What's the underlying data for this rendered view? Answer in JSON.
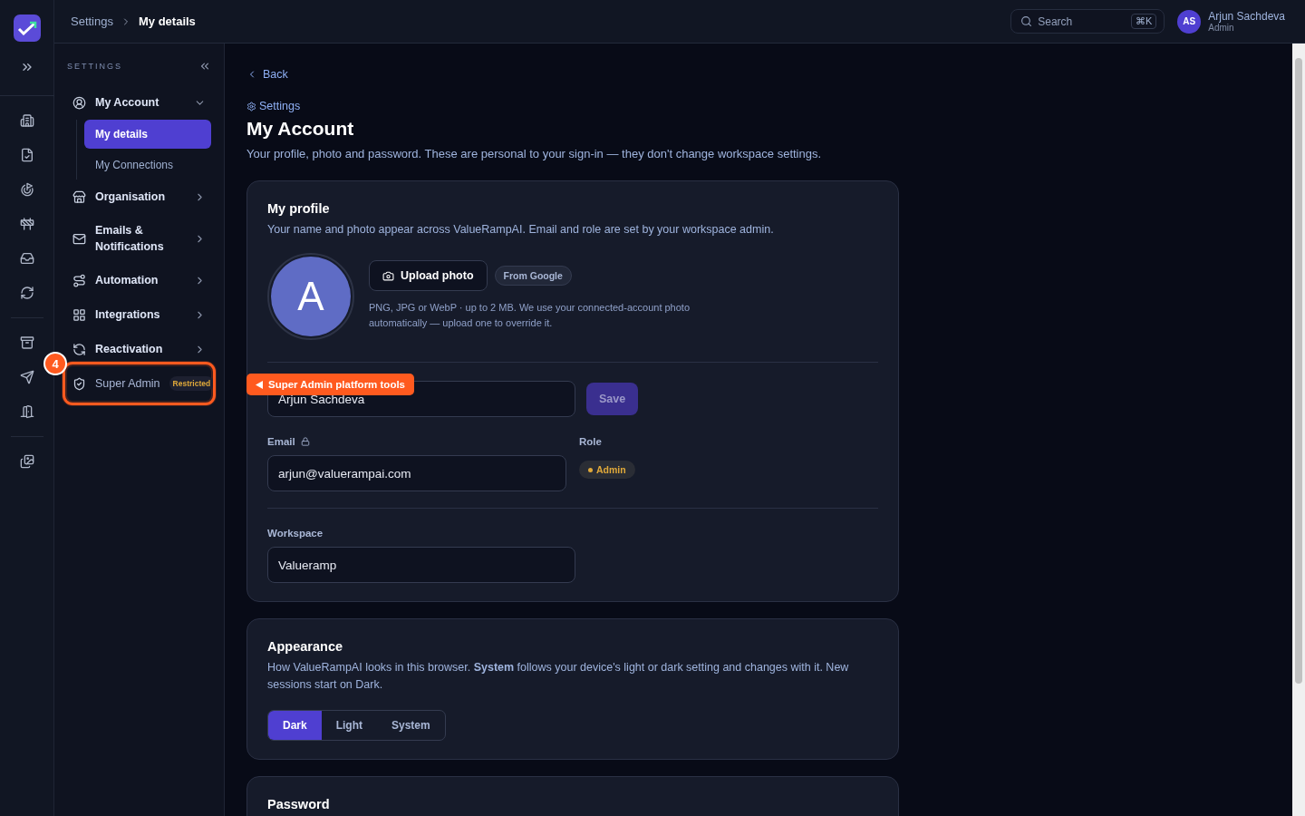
{
  "header": {
    "breadcrumb": [
      {
        "label": "Settings",
        "current": false
      },
      {
        "label": "My details",
        "current": true
      }
    ],
    "search": {
      "placeholder": "Search",
      "shortcut": "⌘K"
    },
    "user": {
      "initials": "AS",
      "name": "Arjun Sachdeva",
      "role": "Admin"
    }
  },
  "sidebar": {
    "heading": "SETTINGS",
    "items": [
      {
        "label": "My Account",
        "expanded": true,
        "children": [
          {
            "label": "My details",
            "selected": true
          },
          {
            "label": "My Connections",
            "selected": false
          }
        ]
      },
      {
        "label": "Organisation",
        "expanded": false
      },
      {
        "label": "Emails & Notifications",
        "expanded": false
      },
      {
        "label": "Automation",
        "expanded": false
      },
      {
        "label": "Integrations",
        "expanded": false
      },
      {
        "label": "Reactivation",
        "expanded": false
      },
      {
        "label": "Super Admin",
        "badge": "Restricted",
        "highlighted": true,
        "step": "4",
        "callout": "Super Admin platform tools"
      }
    ]
  },
  "page": {
    "back": "Back",
    "eyebrow": "Settings",
    "title": "My Account",
    "description": "Your profile, photo and password. These are personal to your sign-in — they don't change workspace settings."
  },
  "profile": {
    "title": "My profile",
    "description": "Your name and photo appear across ValueRampAI. Email and role are set by your workspace admin.",
    "avatar_letter": "A",
    "upload": "Upload photo",
    "source": "From Google",
    "hint": "PNG, JPG or WebP · up to 2 MB. We use your connected-account photo automatically — upload one to override it.",
    "name_value": "Arjun Sachdeva",
    "save": {
      "label": "Save",
      "disabled": true
    },
    "email_label": "Email",
    "email_value": "arjun@valuerampai.com",
    "role_label": "Role",
    "role": "Admin",
    "workspace_label": "Workspace",
    "workspace_value": "Valueramp"
  },
  "appearance": {
    "title": "Appearance",
    "description": "How ValueRampAI looks in this browser. **System** follows your device's light or dark setting and changes with it. New sessions start on Dark.",
    "options": [
      {
        "label": "Dark",
        "selected": true
      },
      {
        "label": "Light",
        "selected": false
      },
      {
        "label": "System",
        "selected": false
      }
    ]
  },
  "password": {
    "title": "Password"
  }
}
